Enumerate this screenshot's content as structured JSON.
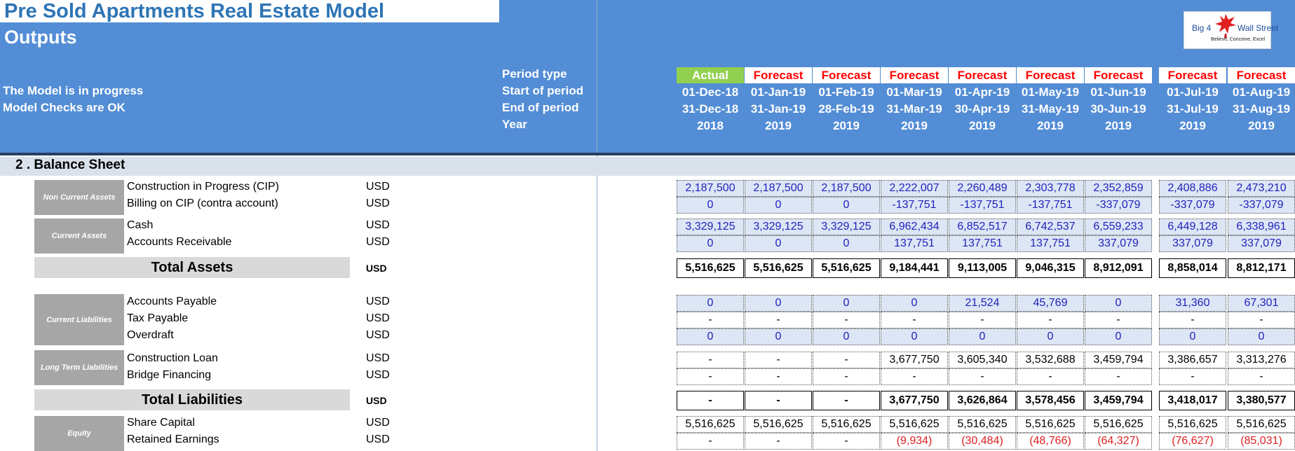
{
  "header": {
    "title": "Pre Sold Apartments Real Estate Model",
    "subtitle": "Outputs",
    "status_progress": "The Model is in progress",
    "status_checks": "Model Checks are OK",
    "row_labels": {
      "period_type": "Period type",
      "start": "Start of period",
      "end": "End of period",
      "year": "Year"
    }
  },
  "logo": {
    "text_left": "Big 4",
    "text_right": "Wall Street",
    "tagline": "Believe, Conceive, Excel",
    "icon": "eagle-icon"
  },
  "colors": {
    "header_blue": "#538DD5",
    "title_blue": "#2E75B6",
    "actual_green": "#92D050",
    "forecast_red": "#FF0000",
    "input_blue": "#2222BB",
    "negative_red": "#E02020"
  },
  "periods": [
    {
      "type": "Actual",
      "start": "01-Dec-18",
      "end": "31-Dec-18",
      "year": "2018"
    },
    {
      "type": "Forecast",
      "start": "01-Jan-19",
      "end": "31-Jan-19",
      "year": "2019"
    },
    {
      "type": "Forecast",
      "start": "01-Feb-19",
      "end": "28-Feb-19",
      "year": "2019"
    },
    {
      "type": "Forecast",
      "start": "01-Mar-19",
      "end": "31-Mar-19",
      "year": "2019"
    },
    {
      "type": "Forecast",
      "start": "01-Apr-19",
      "end": "30-Apr-19",
      "year": "2019"
    },
    {
      "type": "Forecast",
      "start": "01-May-19",
      "end": "31-May-19",
      "year": "2019"
    },
    {
      "type": "Forecast",
      "start": "01-Jun-19",
      "end": "30-Jun-19",
      "year": "2019"
    },
    {
      "type": "Forecast",
      "start": "01-Jul-19",
      "end": "31-Jul-19",
      "year": "2019"
    },
    {
      "type": "Forecast",
      "start": "01-Aug-19",
      "end": "31-Aug-19",
      "year": "2019"
    }
  ],
  "section": {
    "title": "2 . Balance Sheet"
  },
  "groups": {
    "non_current_assets": "Non Current Assets",
    "current_assets": "Current Assets",
    "current_liabilities": "Current Liabilities",
    "long_term_liabilities": "Long Term Liabilities",
    "equity": "Equity"
  },
  "totals": {
    "assets": "Total Assets",
    "liabilities": "Total Liabilities"
  },
  "rows": [
    {
      "label": "Construction in Progress (CIP)",
      "unit": "USD",
      "kind": "input",
      "values": [
        "2,187,500",
        "2,187,500",
        "2,187,500",
        "2,222,007",
        "2,260,489",
        "2,303,778",
        "2,352,859",
        "2,408,886",
        "2,473,210"
      ]
    },
    {
      "label": "Billing on CIP (contra account)",
      "unit": "USD",
      "kind": "input",
      "values": [
        "0",
        "0",
        "0",
        "-137,751",
        "-137,751",
        "-137,751",
        "-337,079",
        "-337,079",
        "-337,079"
      ]
    },
    {
      "label": "Cash",
      "unit": "USD",
      "kind": "input",
      "values": [
        "3,329,125",
        "3,329,125",
        "3,329,125",
        "6,962,434",
        "6,852,517",
        "6,742,537",
        "6,559,233",
        "6,449,128",
        "6,338,961"
      ]
    },
    {
      "label": "Accounts Receivable",
      "unit": "USD",
      "kind": "input",
      "values": [
        "0",
        "0",
        "0",
        "137,751",
        "137,751",
        "137,751",
        "337,079",
        "337,079",
        "337,079"
      ]
    },
    {
      "label": "Total Assets",
      "unit": "USD",
      "kind": "total",
      "values": [
        "5,516,625",
        "5,516,625",
        "5,516,625",
        "9,184,441",
        "9,113,005",
        "9,046,315",
        "8,912,091",
        "8,858,014",
        "8,812,171"
      ]
    },
    {
      "label": "Accounts Payable",
      "unit": "USD",
      "kind": "input",
      "values": [
        "0",
        "0",
        "0",
        "0",
        "21,524",
        "45,769",
        "0",
        "31,360",
        "67,301"
      ]
    },
    {
      "label": "Tax Payable",
      "unit": "USD",
      "kind": "calc",
      "values": [
        "-",
        "-",
        "-",
        "-",
        "-",
        "-",
        "-",
        "-",
        "-"
      ]
    },
    {
      "label": "Overdraft",
      "unit": "USD",
      "kind": "input",
      "values": [
        "0",
        "0",
        "0",
        "0",
        "0",
        "0",
        "0",
        "0",
        "0"
      ]
    },
    {
      "label": "Construction Loan",
      "unit": "USD",
      "kind": "calc",
      "values": [
        "-",
        "-",
        "-",
        "3,677,750",
        "3,605,340",
        "3,532,688",
        "3,459,794",
        "3,386,657",
        "3,313,276"
      ]
    },
    {
      "label": "Bridge Financing",
      "unit": "USD",
      "kind": "calc",
      "values": [
        "-",
        "-",
        "-",
        "-",
        "-",
        "-",
        "-",
        "-",
        "-"
      ]
    },
    {
      "label": "Total Liabilities",
      "unit": "USD",
      "kind": "total",
      "values": [
        "-",
        "-",
        "-",
        "3,677,750",
        "3,626,864",
        "3,578,456",
        "3,459,794",
        "3,418,017",
        "3,380,577"
      ]
    },
    {
      "label": "Share Capital",
      "unit": "USD",
      "kind": "calc",
      "values": [
        "5,516,625",
        "5,516,625",
        "5,516,625",
        "5,516,625",
        "5,516,625",
        "5,516,625",
        "5,516,625",
        "5,516,625",
        "5,516,625"
      ]
    },
    {
      "label": "Retained Earnings",
      "unit": "USD",
      "kind": "calc",
      "values": [
        "-",
        "-",
        "-",
        "(9,934)",
        "(30,484)",
        "(48,766)",
        "(64,327)",
        "(76,627)",
        "(85,031)"
      ]
    }
  ]
}
